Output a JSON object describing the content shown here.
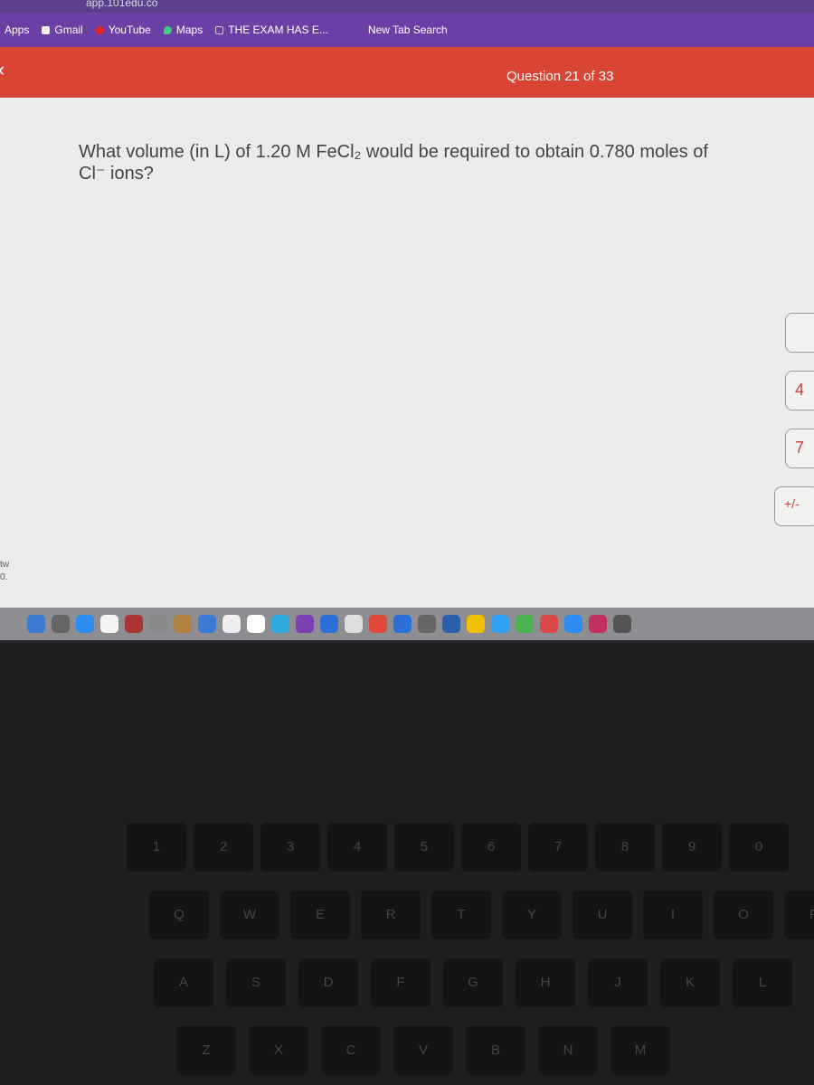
{
  "browser": {
    "url": "app.101edu.co",
    "bookmarks": [
      {
        "label": "Apps",
        "icon": "apps-icon"
      },
      {
        "label": "Gmail",
        "icon": "gmail-icon"
      },
      {
        "label": "YouTube",
        "icon": "youtube-icon"
      },
      {
        "label": "Maps",
        "icon": "maps-icon"
      },
      {
        "label": "THE EXAM HAS E...",
        "icon": "page-icon"
      },
      {
        "label": "New Tab Search",
        "icon": ""
      }
    ]
  },
  "header": {
    "question_counter": "Question 21 of 33",
    "back_icon": "chevron-left-icon"
  },
  "question": {
    "text": "What volume (in L) of 1.20 M FeCl₂ would be required to obtain 0.780 moles of Cl⁻ ions?"
  },
  "keypad": {
    "keys": [
      "",
      "4",
      "7",
      "+/-"
    ]
  },
  "left_edge": {
    "line1": "tw",
    "line2": "0."
  },
  "keyboard": {
    "row1": [
      "1",
      "2",
      "3",
      "4",
      "5",
      "6",
      "7",
      "8",
      "9",
      "0"
    ],
    "row2": [
      "Q",
      "W",
      "E",
      "R",
      "T",
      "Y",
      "U",
      "I",
      "O",
      "P"
    ],
    "row3": [
      "A",
      "S",
      "D",
      "F",
      "G",
      "H",
      "J",
      "K",
      "L"
    ],
    "row4": [
      "Z",
      "X",
      "C",
      "V",
      "B",
      "N",
      "M"
    ]
  }
}
